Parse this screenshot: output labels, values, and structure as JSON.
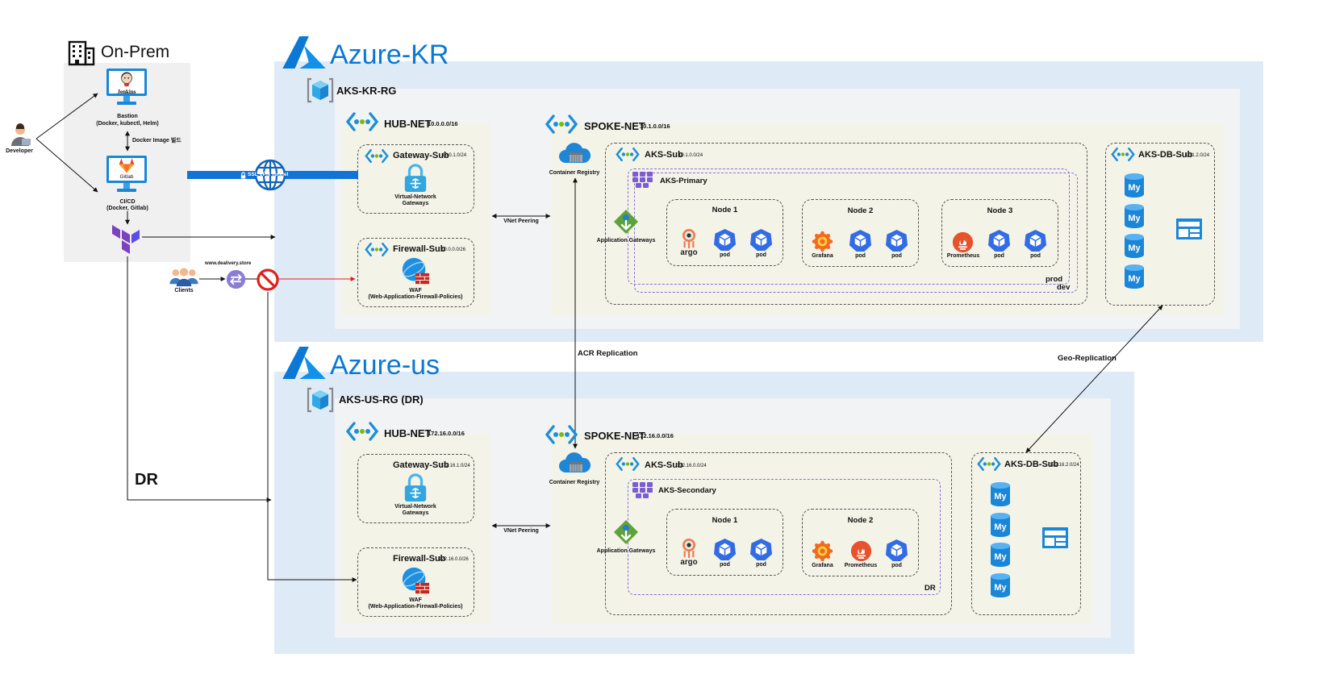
{
  "colors": {
    "region_bg": "#deeaf6",
    "rg_bg": "#f1f3f5",
    "vnet_bg": "#f3f3e8",
    "onprem_bg": "#f0f0f0",
    "azure_blue": "#0a78d4",
    "tunnel": "#1273d6",
    "kube_blue": "#326ce5",
    "aks_purple": "#7c5cd1",
    "block_red": "#e0201b"
  },
  "onprem": {
    "title": "On-Prem",
    "developer": "Developer",
    "jenkins": "Jenkins",
    "bastion": "Bastion\n(Docker, kubectl, Helm)",
    "docker_build": "Docker Image 빌드",
    "gitlab": "Gitlab",
    "cicd": "CI/CD\n(Docker, Gitlab)"
  },
  "clients": {
    "label": "Clients",
    "domain": "www.dealivery.store"
  },
  "vpn_tunnel": "SSL VPN Tunnel",
  "dr_label": "DR",
  "acr_replication": "ACR Replication",
  "geo_replication": "Geo-Replication",
  "kr": {
    "region": "Azure-KR",
    "rg": "AKS-KR-RG",
    "hub": {
      "name": "HUB-NET",
      "cidr": "10.0.0.0/16"
    },
    "gateway_sub": {
      "name": "Gateway-Sub",
      "cidr": "10.0.1.0/24",
      "item": "Virtual-Network\nGateways"
    },
    "firewall_sub": {
      "name": "Firewall-Sub",
      "cidr": "10.0.0.0/26",
      "item": "WAF\n(Web-Application-Firewall-Policies)"
    },
    "vnet_peering": "VNet Peering",
    "spoke": {
      "name": "SPOKE-NET",
      "cidr": "10.1.0.0/16"
    },
    "container_registry": "Container Registry",
    "aks_sub": {
      "name": "AKS-Sub",
      "cidr": "10.1.0.0/24"
    },
    "cluster": "AKS-Primary",
    "app_gw": "Application Gateways",
    "nodes": [
      {
        "title": "Node 1",
        "app": "argo",
        "pod1": "pod",
        "pod2": "pod"
      },
      {
        "title": "Node 2",
        "app": "Grafana",
        "pod1": "pod",
        "pod2": "pod"
      },
      {
        "title": "Node 3",
        "app": "Prometheus",
        "pod1": "pod",
        "pod2": "pod"
      }
    ],
    "env_prod": "prod",
    "env_dev": "dev",
    "db_sub": {
      "name": "AKS-DB-Sub",
      "cidr": "10.1.2.0/24"
    },
    "db_label": "My"
  },
  "us": {
    "region": "Azure-us",
    "rg": "AKS-US-RG (DR)",
    "hub": {
      "name": "HUB-NET",
      "cidr": "172.16.0.0/16"
    },
    "gateway_sub": {
      "name": "Gateway-Sub",
      "cidr": "172.16.1.0/24",
      "item": "Virtual-Network\nGateways"
    },
    "firewall_sub": {
      "name": "Firewall-Sub",
      "cidr": "172.16.0.0/26",
      "item": "WAF\n(Web-Application-Firewall-Policies)"
    },
    "vnet_peering": "VNet Peering",
    "spoke": {
      "name": "SPOKE-NET",
      "cidr": "172.16.0.0/16"
    },
    "container_registry": "Container Registry",
    "aks_sub": {
      "name": "AKS-Sub",
      "cidr": "172.16.0.0/24"
    },
    "cluster": "AKS-Secondary",
    "app_gw": "Application Gateways",
    "nodes": [
      {
        "title": "Node 1",
        "app": "argo",
        "pod1": "pod",
        "pod2": "pod"
      },
      {
        "title": "Node 2",
        "app": "Grafana",
        "app2": "Prometheus",
        "pod1": "pod"
      }
    ],
    "env_dr": "DR",
    "db_sub": {
      "name": "AKS-DB-Sub",
      "cidr": "172.16.2.0/24"
    },
    "db_label": "My"
  }
}
